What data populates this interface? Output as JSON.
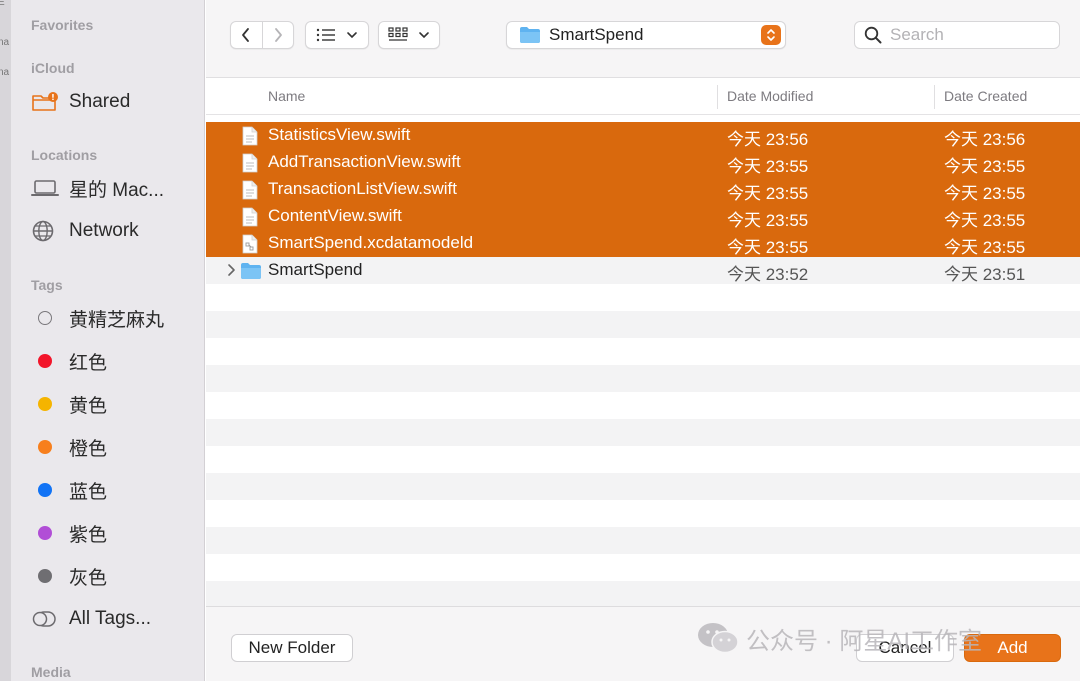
{
  "sidebar": {
    "sections": {
      "favorites": "Favorites",
      "icloud": "iCloud",
      "locations": "Locations",
      "tags": "Tags",
      "media": "Media"
    },
    "behind_text": [
      "E",
      "na",
      "na"
    ],
    "icloud_items": [
      {
        "label": "Shared",
        "icon": "shared-folder-icon"
      }
    ],
    "location_items": [
      {
        "label": "星的 Mac...",
        "icon": "laptop-icon"
      },
      {
        "label": "Network",
        "icon": "globe-icon"
      }
    ],
    "tag_items": [
      {
        "label": "黄精芝麻丸",
        "color": ""
      },
      {
        "label": "红色",
        "color": "#f2152a"
      },
      {
        "label": "黄色",
        "color": "#f5b400"
      },
      {
        "label": "橙色",
        "color": "#f77f1d"
      },
      {
        "label": "蓝色",
        "color": "#1173f5"
      },
      {
        "label": "紫色",
        "color": "#b14ed6"
      },
      {
        "label": "灰色",
        "color": "#6f6e72"
      },
      {
        "label": "All Tags...",
        "icon": "all-tags-icon"
      }
    ]
  },
  "toolbar": {
    "path": "SmartSpend",
    "search_placeholder": "Search"
  },
  "columns": {
    "name": "Name",
    "date_modified": "Date Modified",
    "date_created": "Date Created"
  },
  "files": [
    {
      "name": "StatisticsView.swift",
      "modified": "今天 23:56",
      "created": "今天 23:56",
      "kind": "file",
      "selected": true
    },
    {
      "name": "AddTransactionView.swift",
      "modified": "今天 23:55",
      "created": "今天 23:55",
      "kind": "file",
      "selected": true
    },
    {
      "name": "TransactionListView.swift",
      "modified": "今天 23:55",
      "created": "今天 23:55",
      "kind": "file",
      "selected": true
    },
    {
      "name": "ContentView.swift",
      "modified": "今天 23:55",
      "created": "今天 23:55",
      "kind": "file",
      "selected": true
    },
    {
      "name": "SmartSpend.xcdatamodeld",
      "modified": "今天 23:55",
      "created": "今天 23:55",
      "kind": "datamodel",
      "selected": true
    },
    {
      "name": "SmartSpend",
      "modified": "今天 23:52",
      "created": "今天 23:51",
      "kind": "folder",
      "selected": false
    }
  ],
  "bottom": {
    "new_folder": "New Folder",
    "cancel": "Cancel",
    "add": "Add"
  },
  "watermark": "公众号 · 阿星AI工作室",
  "colors": {
    "accent": "#e8731a",
    "selection": "#d9690d",
    "folder_blue": "#5fb3f0"
  }
}
